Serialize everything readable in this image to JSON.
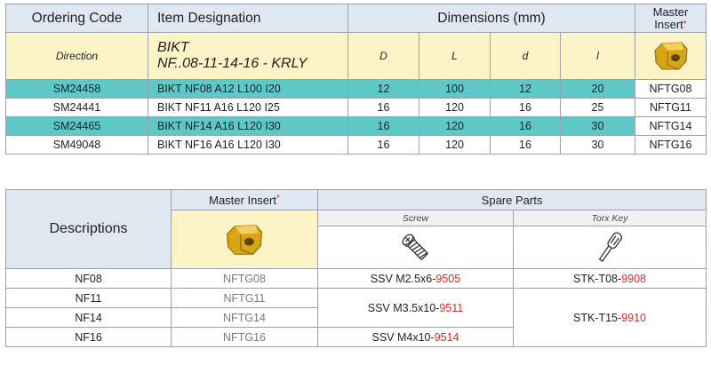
{
  "table1": {
    "headers": {
      "ordering_code": "Ordering Code",
      "item_designation": "Item Designation",
      "dimensions": "Dimensions (mm)",
      "master_insert": "Master Insert",
      "star": "*"
    },
    "direction_row": {
      "label": "Direction",
      "designation_line1": "BIKT",
      "designation_line2": "NF..08-11-14-16 -  KRLY",
      "D": "D",
      "L": "L",
      "d": "d",
      "l": "l"
    },
    "rows": [
      {
        "code": "SM24458",
        "designation": "BIKT NF08 A12 L100 I20",
        "D": "12",
        "L": "100",
        "d": "12",
        "l": "20",
        "insert": "NFTG08"
      },
      {
        "code": "SM24441",
        "designation": "BIKT NF11 A16 L120 I25",
        "D": "16",
        "L": "120",
        "d": "16",
        "l": "25",
        "insert": "NFTG11"
      },
      {
        "code": "SM24465",
        "designation": "BIKT NF14 A16 L120 I30",
        "D": "16",
        "L": "120",
        "d": "16",
        "l": "30",
        "insert": "NFTG14"
      },
      {
        "code": "SM49048",
        "designation": "BIKT NF16 A16 L120 I30",
        "D": "16",
        "L": "120",
        "d": "16",
        "l": "30",
        "insert": "NFTG16"
      }
    ],
    "colors": {
      "teal": "#5ec7c7",
      "header": "#dfe7f1",
      "direction": "#fcf4c6",
      "insert_gold": "#d8a517"
    }
  },
  "table2": {
    "headers": {
      "descriptions": "Descriptions",
      "master_insert": "Master Insert",
      "star": "*",
      "spare_parts": "Spare Parts",
      "screw": "Screw",
      "torx_key": "Torx Key"
    },
    "icons": {
      "insert": "insert-icon",
      "screw": "screw-icon",
      "key": "torx-key-icon"
    },
    "rows": [
      {
        "desc": "NF08",
        "insert": "NFTG08"
      },
      {
        "desc": "NF11",
        "insert": "NFTG11"
      },
      {
        "desc": "NF14",
        "insert": "NFTG14"
      },
      {
        "desc": "NF16",
        "insert": "NFTG16"
      }
    ],
    "screws": [
      {
        "prefix": "SSV M2.5x6-",
        "code": "9505"
      },
      {
        "prefix": "SSV M3.5x10-",
        "code": "9511"
      },
      {
        "prefix": "SSV M4x10-",
        "code": "9514"
      }
    ],
    "keys": [
      {
        "prefix": "STK-T08-",
        "code": "9908"
      },
      {
        "prefix": "STK-T15-",
        "code": "9910"
      }
    ],
    "colors": {
      "red_code": "#e3262d",
      "grey_text": "#7a7a7a"
    }
  }
}
